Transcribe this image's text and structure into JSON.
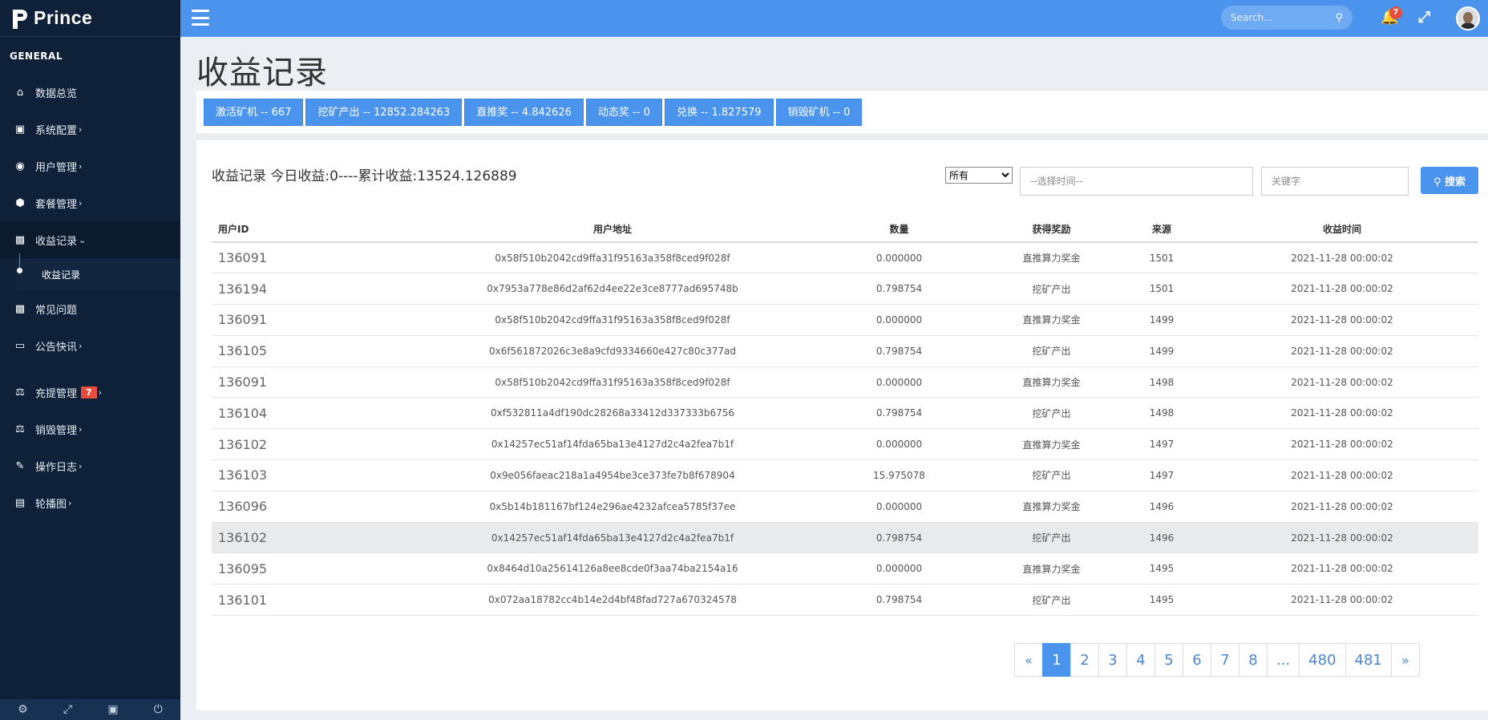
{
  "brand": {
    "name": "Prince"
  },
  "sidebar": {
    "section_title": "GENERAL",
    "items": [
      {
        "label": "数据总览",
        "icon": "home-icon",
        "caret": ""
      },
      {
        "label": "系统配置",
        "icon": "monitor-icon",
        "caret": "›"
      },
      {
        "label": "用户管理",
        "icon": "user-circle-icon",
        "caret": "›"
      },
      {
        "label": "套餐管理",
        "icon": "cube-icon",
        "caret": "›"
      },
      {
        "label": "收益记录",
        "icon": "money-icon",
        "caret": "⌄"
      },
      {
        "label": "常见问题",
        "icon": "money-icon",
        "caret": ""
      },
      {
        "label": "公告快讯",
        "icon": "window-icon",
        "caret": "›"
      },
      {
        "label": "充提管理",
        "icon": "scale-icon",
        "caret": "›",
        "badge": "7"
      },
      {
        "label": "销毁管理",
        "icon": "scale-icon",
        "caret": "›"
      },
      {
        "label": "操作日志",
        "icon": "edit-icon",
        "caret": "›"
      },
      {
        "label": "轮播图",
        "icon": "image-icon",
        "caret": "›"
      }
    ],
    "sub_item": {
      "label": "收益记录"
    }
  },
  "topbar": {
    "search_placeholder": "Search...",
    "notification_count": "7"
  },
  "page": {
    "title": "收益记录",
    "stats": [
      "激活矿机 -- 667",
      "挖矿产出 -- 12852.284263",
      "直推奖 -- 4.842626",
      "动态奖 -- 0",
      "兑换 -- 1.827579",
      "销毁矿机 -- 0"
    ],
    "panel_title": "收益记录 今日收益:0----累计收益:13524.126889",
    "filter": {
      "select_value": "所有",
      "date_placeholder": "--选择时间--",
      "keyword_placeholder": "关键字",
      "search_label": "搜索"
    }
  },
  "table": {
    "columns": [
      "用户ID",
      "用户地址",
      "数量",
      "获得奖励",
      "来源",
      "收益时间"
    ],
    "rows": [
      {
        "uid": "136091",
        "address": "0x58f510b2042cd9ffa31f95163a358f8ced9f028f",
        "amount": "0.000000",
        "reward": "直推算力奖金",
        "source": "1501",
        "time": "2021-11-28 00:00:02"
      },
      {
        "uid": "136194",
        "address": "0x7953a778e86d2af62d4ee22e3ce8777ad695748b",
        "amount": "0.798754",
        "reward": "挖矿产出",
        "source": "1501",
        "time": "2021-11-28 00:00:02"
      },
      {
        "uid": "136091",
        "address": "0x58f510b2042cd9ffa31f95163a358f8ced9f028f",
        "amount": "0.000000",
        "reward": "直推算力奖金",
        "source": "1499",
        "time": "2021-11-28 00:00:02"
      },
      {
        "uid": "136105",
        "address": "0x6f561872026c3e8a9cfd9334660e427c80c377ad",
        "amount": "0.798754",
        "reward": "挖矿产出",
        "source": "1499",
        "time": "2021-11-28 00:00:02"
      },
      {
        "uid": "136091",
        "address": "0x58f510b2042cd9ffa31f95163a358f8ced9f028f",
        "amount": "0.000000",
        "reward": "直推算力奖金",
        "source": "1498",
        "time": "2021-11-28 00:00:02"
      },
      {
        "uid": "136104",
        "address": "0xf532811a4df190dc28268a33412d337333b6756",
        "amount": "0.798754",
        "reward": "挖矿产出",
        "source": "1498",
        "time": "2021-11-28 00:00:02"
      },
      {
        "uid": "136102",
        "address": "0x14257ec51af14fda65ba13e4127d2c4a2fea7b1f",
        "amount": "0.000000",
        "reward": "直推算力奖金",
        "source": "1497",
        "time": "2021-11-28 00:00:02"
      },
      {
        "uid": "136103",
        "address": "0x9e056faeac218a1a4954be3ce373fe7b8f678904",
        "amount": "15.975078",
        "reward": "挖矿产出",
        "source": "1497",
        "time": "2021-11-28 00:00:02"
      },
      {
        "uid": "136096",
        "address": "0x5b14b181167bf124e296ae4232afcea5785f37ee",
        "amount": "0.000000",
        "reward": "直推算力奖金",
        "source": "1496",
        "time": "2021-11-28 00:00:02"
      },
      {
        "uid": "136102",
        "address": "0x14257ec51af14fda65ba13e4127d2c4a2fea7b1f",
        "amount": "0.798754",
        "reward": "挖矿产出",
        "source": "1496",
        "time": "2021-11-28 00:00:02"
      },
      {
        "uid": "136095",
        "address": "0x8464d10a25614126a8ee8cde0f3aa74ba2154a16",
        "amount": "0.000000",
        "reward": "直推算力奖金",
        "source": "1495",
        "time": "2021-11-28 00:00:02"
      },
      {
        "uid": "136101",
        "address": "0x072aa18782cc4b14e2d4bf48fad727a670324578",
        "amount": "0.798754",
        "reward": "挖矿产出",
        "source": "1495",
        "time": "2021-11-28 00:00:02"
      }
    ]
  },
  "pagination": {
    "prev": "«",
    "pages": [
      "1",
      "2",
      "3",
      "4",
      "5",
      "6",
      "7",
      "8",
      "...",
      "480",
      "481"
    ],
    "next": "»",
    "active": "1"
  }
}
